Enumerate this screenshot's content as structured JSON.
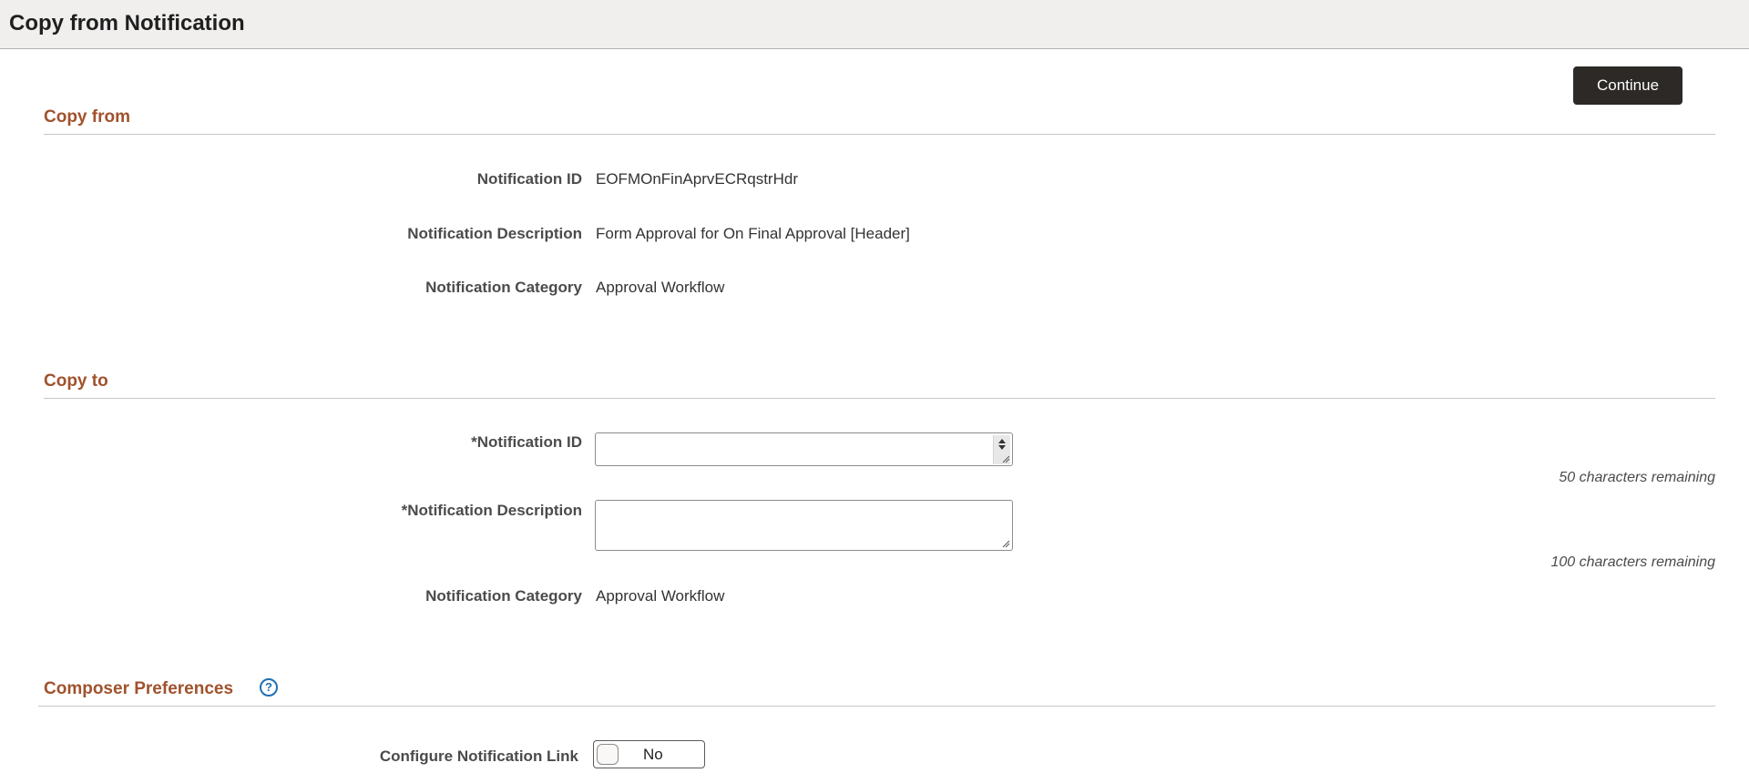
{
  "page": {
    "title": "Copy from Notification"
  },
  "toolbar": {
    "continue_label": "Continue"
  },
  "copy_from": {
    "section_title": "Copy from",
    "notification_id_label": "Notification ID",
    "notification_id_value": "EOFMOnFinAprvECRqstrHdr",
    "notification_description_label": "Notification Description",
    "notification_description_value": "Form Approval for On Final Approval [Header]",
    "notification_category_label": "Notification Category",
    "notification_category_value": "Approval Workflow"
  },
  "copy_to": {
    "section_title": "Copy to",
    "notification_id_label": "*Notification ID",
    "notification_id_value": "",
    "notification_id_hint": "50 characters remaining",
    "notification_description_label": "*Notification Description",
    "notification_description_value": "",
    "notification_description_hint": "100 characters remaining",
    "notification_category_label": "Notification Category",
    "notification_category_value": "Approval Workflow"
  },
  "composer_preferences": {
    "section_title": "Composer Preferences",
    "help_icon": "help-icon",
    "help_glyph": "?",
    "configure_link_label": "Configure Notification Link",
    "configure_link_value": "No"
  },
  "colors": {
    "section_title": "#a0522d",
    "button_bg": "#2c2926",
    "help_icon": "#1f6fb5",
    "title_bar_bg": "#f0efee"
  }
}
